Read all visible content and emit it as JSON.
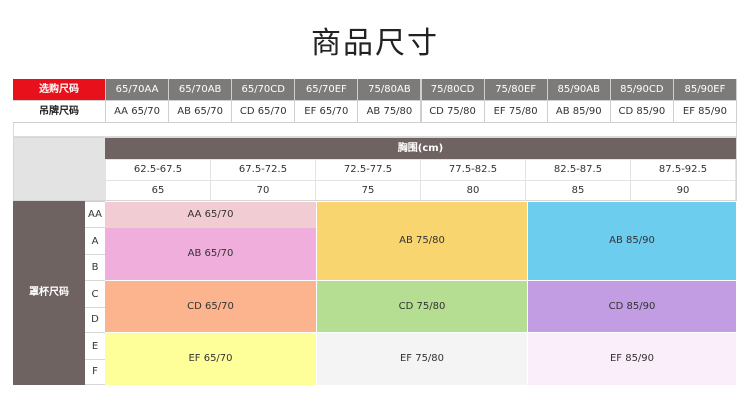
{
  "title": "商品尺寸",
  "size_table": {
    "row1_label": "选购尺码",
    "row2_label": "吊牌尺码",
    "purchase_sizes": [
      "65/70AA",
      "65/70AB",
      "65/70CD",
      "65/70EF",
      "75/80AB",
      "75/80CD",
      "75/80EF",
      "85/90AB",
      "85/90CD",
      "85/90EF"
    ],
    "tag_sizes": [
      "AA 65/70",
      "AB 65/70",
      "CD 65/70",
      "EF 65/70",
      "AB 75/80",
      "CD 75/80",
      "EF 75/80",
      "AB 85/90",
      "CD 85/90",
      "EF 85/90"
    ]
  },
  "chart": {
    "chest_header": "胸围(cm)",
    "chest_ranges": [
      "62.5-67.5",
      "67.5-72.5",
      "72.5-77.5",
      "77.5-82.5",
      "82.5-87.5",
      "87.5-92.5"
    ],
    "band_sizes": [
      "65",
      "70",
      "75",
      "80",
      "85",
      "90"
    ],
    "cup_label": "罩杯尺码",
    "cups": [
      "AA",
      "A",
      "B",
      "C",
      "D",
      "E",
      "F"
    ],
    "blocks": {
      "aa_65_70": "AA 65/70",
      "ab_65_70": "AB 65/70",
      "ab_75_80": "AB 75/80",
      "ab_85_90": "AB 85/90",
      "cd_65_70": "CD 65/70",
      "cd_75_80": "CD 75/80",
      "cd_85_90": "CD 85/90",
      "ef_65_70": "EF 65/70",
      "ef_75_80": "EF 75/80",
      "ef_85_90": "EF 85/90"
    }
  },
  "colors": {
    "header_red": "#e8111b",
    "header_gray": "#7d7b7a",
    "dark_label": "#6e6360",
    "aa": "#f2ccd3",
    "ab_65": "#f0aedd",
    "ab_75": "#f9d56f",
    "ab_85": "#6dcdee",
    "cd_65": "#fbb48d",
    "cd_75": "#b6de92",
    "cd_85": "#c29de3",
    "ef_65": "#ffff99",
    "ef_75": "#f4f4f4",
    "ef_85": "#fbeefb"
  }
}
